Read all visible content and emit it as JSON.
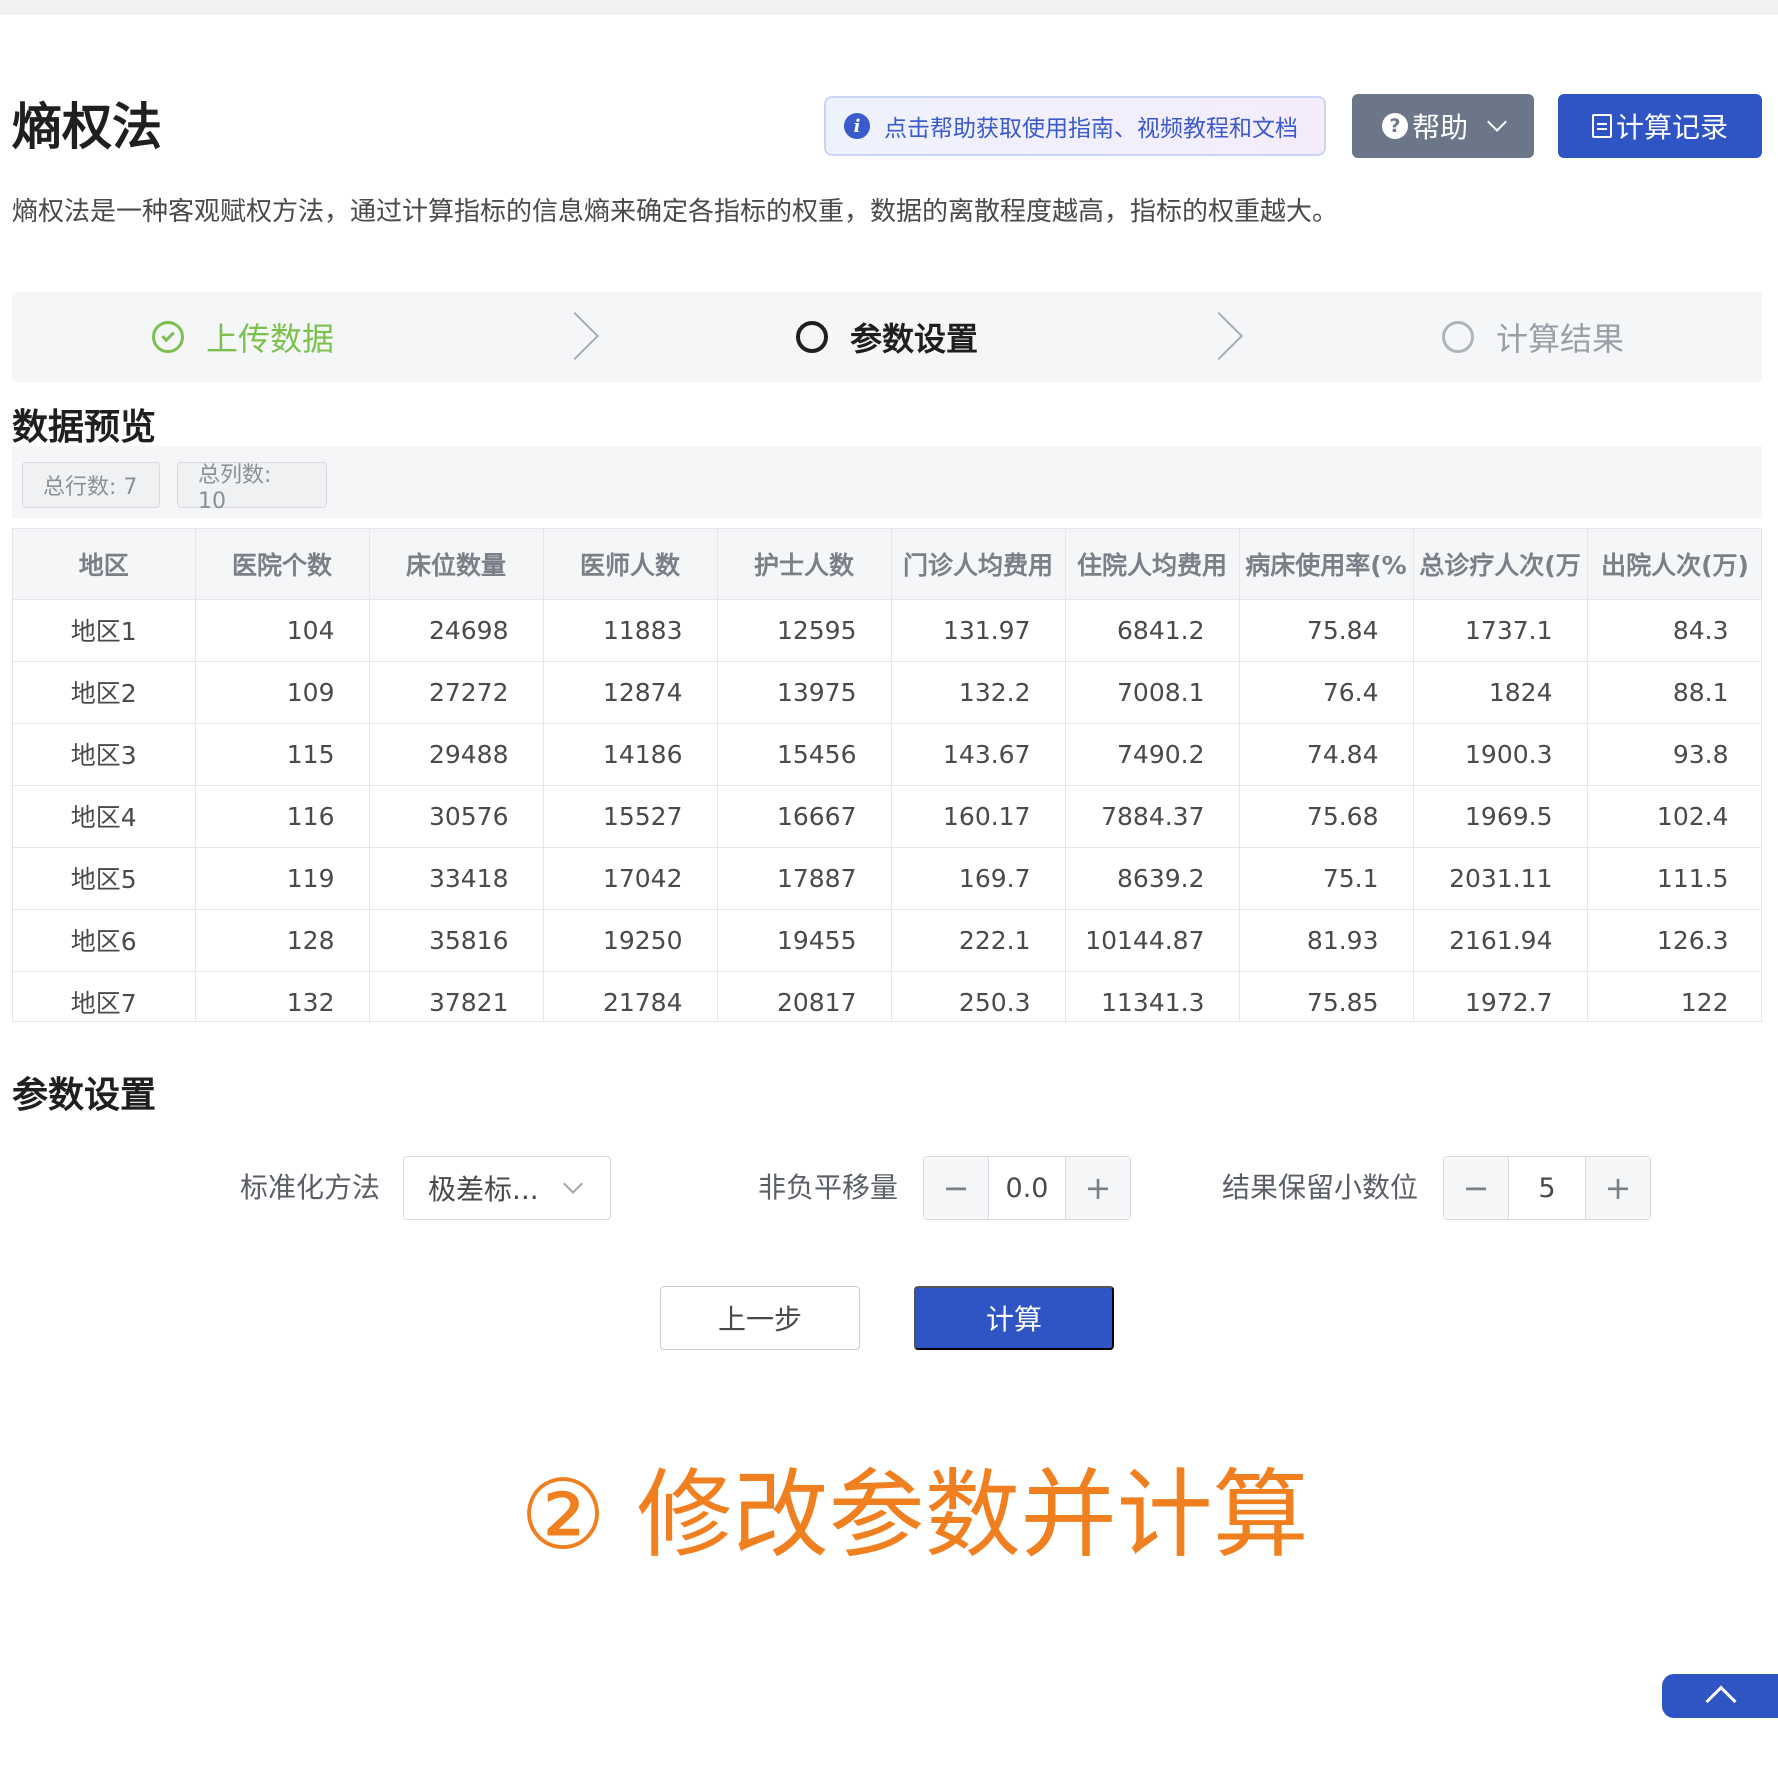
{
  "page": {
    "title": "熵权法",
    "description": "熵权法是一种客观赋权方法，通过计算指标的信息熵来确定各指标的权重，数据的离散程度越高，指标的权重越大。"
  },
  "header": {
    "help_hint": "点击帮助获取使用指南、视频教程和文档",
    "help_label": "帮助",
    "records_label": "计算记录"
  },
  "steps": [
    {
      "label": "上传数据",
      "state": "done"
    },
    {
      "label": "参数设置",
      "state": "active"
    },
    {
      "label": "计算结果",
      "state": "pending"
    }
  ],
  "preview": {
    "title": "数据预览",
    "rows_tag": "总行数: 7",
    "cols_tag": "总列数: 10",
    "columns": [
      "地区",
      "医院个数",
      "床位数量",
      "医师人数",
      "护士人数",
      "门诊人均费用",
      "住院人均费用",
      "病床使用率(%",
      "总诊疗人次(万",
      "出院人次(万)"
    ],
    "rows": [
      [
        "地区1",
        "104",
        "24698",
        "11883",
        "12595",
        "131.97",
        "6841.2",
        "75.84",
        "1737.1",
        "84.3"
      ],
      [
        "地区2",
        "109",
        "27272",
        "12874",
        "13975",
        "132.2",
        "7008.1",
        "76.4",
        "1824",
        "88.1"
      ],
      [
        "地区3",
        "115",
        "29488",
        "14186",
        "15456",
        "143.67",
        "7490.2",
        "74.84",
        "1900.3",
        "93.8"
      ],
      [
        "地区4",
        "116",
        "30576",
        "15527",
        "16667",
        "160.17",
        "7884.37",
        "75.68",
        "1969.5",
        "102.4"
      ],
      [
        "地区5",
        "119",
        "33418",
        "17042",
        "17887",
        "169.7",
        "8639.2",
        "75.1",
        "2031.11",
        "111.5"
      ],
      [
        "地区6",
        "128",
        "35816",
        "19250",
        "19455",
        "222.1",
        "10144.87",
        "81.93",
        "2161.94",
        "126.3"
      ],
      [
        "地区7",
        "132",
        "37821",
        "21784",
        "20817",
        "250.3",
        "11341.3",
        "75.85",
        "1972.7",
        "122"
      ]
    ]
  },
  "params": {
    "title": "参数设置",
    "method_label": "标准化方法",
    "method_value": "极差标...",
    "shift_label": "非负平移量",
    "shift_value": "0.0",
    "decimals_label": "结果保留小数位",
    "decimals_value": "5"
  },
  "actions": {
    "prev_label": "上一步",
    "calc_label": "计算"
  },
  "annotation": "② 修改参数并计算",
  "colors": {
    "primary": "#2f55c4",
    "success": "#7cc14e",
    "annotation": "#f07f1f"
  }
}
